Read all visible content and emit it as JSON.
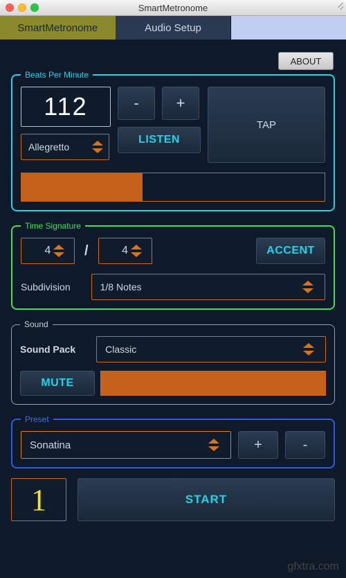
{
  "window": {
    "title": "SmartMetronome"
  },
  "tabs": {
    "app": "SmartMetronome",
    "audio": "Audio Setup"
  },
  "about_label": "ABOUT",
  "bpm": {
    "legend": "Beats Per Minute",
    "value": "112",
    "minus": "-",
    "plus": "+",
    "tap": "TAP",
    "tempo_name": "Allegretto",
    "listen": "LISTEN",
    "progress_percent": 40
  },
  "ts": {
    "legend": "Time Signature",
    "numerator": "4",
    "denominator": "4",
    "slash": "/",
    "accent": "ACCENT",
    "subdivision_label": "Subdivision",
    "subdivision_value": "1/8 Notes"
  },
  "sound": {
    "legend": "Sound",
    "pack_label": "Sound Pack",
    "pack_value": "Classic",
    "mute": "MUTE"
  },
  "preset": {
    "legend": "Preset",
    "value": "Sonatina",
    "plus": "+",
    "minus": "-"
  },
  "beat_counter": "1",
  "start_label": "START",
  "watermark": "gfxtra.com"
}
